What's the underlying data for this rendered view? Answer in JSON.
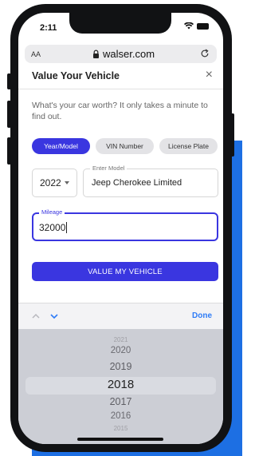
{
  "status": {
    "time": "2:11"
  },
  "browser": {
    "aa_label": "AA",
    "url": "walser.com"
  },
  "modal": {
    "title": "Value Your Vehicle",
    "close_label": "×",
    "description": "What's your car worth? It only takes a minute to find out."
  },
  "tabs": [
    {
      "label": "Year/Model",
      "active": true
    },
    {
      "label": "VIN Number",
      "active": false
    },
    {
      "label": "License Plate",
      "active": false
    }
  ],
  "form": {
    "year_value": "2022",
    "model_label": "Enter Model",
    "model_value": "Jeep Cherokee Limited",
    "mileage_label": "Mileage",
    "mileage_value": "32000",
    "submit_label": "VALUE MY VEHICLE"
  },
  "keyboard": {
    "done_label": "Done",
    "picker_years": [
      "2021",
      "2020",
      "2019",
      "2018",
      "2017",
      "2016",
      "2015"
    ],
    "selected_year": "2018"
  },
  "colors": {
    "accent": "#3a36e0",
    "link": "#2f7cf6",
    "background_brand": "#1d6fe3"
  }
}
